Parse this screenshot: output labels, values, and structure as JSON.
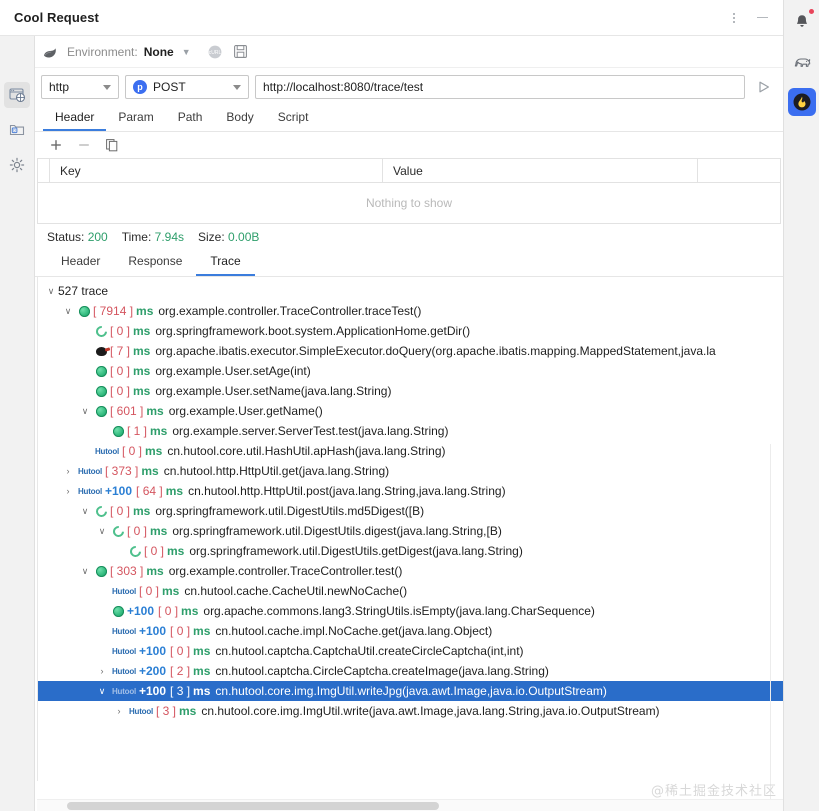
{
  "window": {
    "title": "Cool Request",
    "controls": {
      "menu_icon": "kebab-menu-icon",
      "minimize_icon": "minimize-icon"
    }
  },
  "left_rail": {
    "items": [
      {
        "name": "request-icon",
        "glyph": "globe-window-icon",
        "active": true
      },
      {
        "name": "collection-icon",
        "glyph": "folder-doc-icon",
        "active": false
      },
      {
        "name": "settings-icon",
        "glyph": "gear-icon",
        "active": false
      }
    ]
  },
  "right_rail": {
    "items": [
      {
        "name": "notifications-icon",
        "glyph": "bell-icon",
        "badge": true,
        "active": false
      },
      {
        "name": "plugin-icon",
        "glyph": "dinosaur-icon",
        "badge": false,
        "active": false
      },
      {
        "name": "coolrequest-icon",
        "glyph": "flame-icon",
        "badge": false,
        "active": true
      }
    ]
  },
  "environment_bar": {
    "leaf_icon": "spring-leaf-icon",
    "label": "Environment:",
    "value": "None",
    "caret": "∨",
    "curl_icon": "curl-icon",
    "save_icon": "save-disk-icon"
  },
  "url_bar": {
    "protocol": "http",
    "method": "POST",
    "method_badge": "p",
    "url": "http://localhost:8080/trace/test",
    "url_placeholder": "http://localhost:8080/trace/test",
    "send_icon": "send-play-icon",
    "accent": "#3b6ef0"
  },
  "request_tabs": {
    "items": [
      "Header",
      "Param",
      "Path",
      "Body",
      "Script"
    ],
    "active": "Header"
  },
  "kv_toolbar": {
    "add_label": "+",
    "remove_label": "−",
    "copy_icon": "copy-icon"
  },
  "kv_table": {
    "columns": [
      "Key",
      "Value"
    ],
    "rows": [],
    "empty_text": "Nothing to show"
  },
  "status": {
    "status_label": "Status:",
    "status_value": "200",
    "time_label": "Time:",
    "time_value": "7.94s",
    "size_label": "Size:",
    "size_value": "0.00B",
    "value_color": "#2e9e6b"
  },
  "response_tabs": {
    "items": [
      "Header",
      "Response",
      "Trace"
    ],
    "active": "Trace"
  },
  "trace": {
    "root_label": "527 trace",
    "selected_index": 19,
    "rows": [
      {
        "indent": 0,
        "twisty": "open",
        "icon": "none",
        "hutool": "",
        "plus": "",
        "dur": "",
        "ms": "",
        "sig": "527 trace",
        "root": true
      },
      {
        "indent": 1,
        "twisty": "open",
        "icon": "java",
        "hutool": "",
        "plus": "",
        "dur": "[ 7914 ]",
        "ms": "ms",
        "sig": "org.example.controller.TraceController.traceTest()"
      },
      {
        "indent": 2,
        "twisty": "none",
        "icon": "spring",
        "hutool": "",
        "plus": "",
        "dur": "[ 0 ]",
        "ms": "ms",
        "sig": "org.springframework.boot.system.ApplicationHome.getDir()"
      },
      {
        "indent": 2,
        "twisty": "none",
        "icon": "mybatis",
        "hutool": "",
        "plus": "",
        "dur": "[ 7 ]",
        "ms": "ms",
        "sig": "org.apache.ibatis.executor.SimpleExecutor.doQuery(org.apache.ibatis.mapping.MappedStatement,java.la"
      },
      {
        "indent": 2,
        "twisty": "none",
        "icon": "java",
        "hutool": "",
        "plus": "",
        "dur": "[ 0 ]",
        "ms": "ms",
        "sig": "org.example.User.setAge(int)"
      },
      {
        "indent": 2,
        "twisty": "none",
        "icon": "java",
        "hutool": "",
        "plus": "",
        "dur": "[ 0 ]",
        "ms": "ms",
        "sig": "org.example.User.setName(java.lang.String)"
      },
      {
        "indent": 2,
        "twisty": "open",
        "icon": "java",
        "hutool": "",
        "plus": "",
        "dur": "[ 601 ]",
        "ms": "ms",
        "sig": "org.example.User.getName()"
      },
      {
        "indent": 3,
        "twisty": "none",
        "icon": "java",
        "hutool": "",
        "plus": "",
        "dur": "[ 1 ]",
        "ms": "ms",
        "sig": "org.example.server.ServerTest.test(java.lang.String)"
      },
      {
        "indent": 2,
        "twisty": "none",
        "icon": "none",
        "hutool": "Hutool",
        "plus": "",
        "dur": "[ 0 ]",
        "ms": "ms",
        "sig": "cn.hutool.core.util.HashUtil.apHash(java.lang.String)"
      },
      {
        "indent": 1,
        "twisty": "closed",
        "icon": "none",
        "hutool": "Hutool",
        "plus": "",
        "dur": "[ 373 ]",
        "ms": "ms",
        "sig": "cn.hutool.http.HttpUtil.get(java.lang.String)"
      },
      {
        "indent": 1,
        "twisty": "closed",
        "icon": "none",
        "hutool": "Hutool",
        "plus": "+100",
        "dur": "[ 64 ]",
        "ms": "ms",
        "sig": "cn.hutool.http.HttpUtil.post(java.lang.String,java.lang.String)"
      },
      {
        "indent": 2,
        "twisty": "open",
        "icon": "spring",
        "hutool": "",
        "plus": "",
        "dur": "[ 0 ]",
        "ms": "ms",
        "sig": "org.springframework.util.DigestUtils.md5Digest([B)"
      },
      {
        "indent": 3,
        "twisty": "open",
        "icon": "spring",
        "hutool": "",
        "plus": "",
        "dur": "[ 0 ]",
        "ms": "ms",
        "sig": "org.springframework.util.DigestUtils.digest(java.lang.String,[B)"
      },
      {
        "indent": 4,
        "twisty": "none",
        "icon": "spring",
        "hutool": "",
        "plus": "",
        "dur": "[ 0 ]",
        "ms": "ms",
        "sig": "org.springframework.util.DigestUtils.getDigest(java.lang.String)"
      },
      {
        "indent": 2,
        "twisty": "open",
        "icon": "java",
        "hutool": "",
        "plus": "",
        "dur": "[ 303 ]",
        "ms": "ms",
        "sig": "org.example.controller.TraceController.test()"
      },
      {
        "indent": 3,
        "twisty": "none",
        "icon": "none",
        "hutool": "Hutool",
        "plus": "",
        "dur": "[ 0 ]",
        "ms": "ms",
        "sig": "cn.hutool.cache.CacheUtil.newNoCache()"
      },
      {
        "indent": 3,
        "twisty": "none",
        "icon": "java",
        "hutool": "",
        "plus": "+100",
        "dur": "[ 0 ]",
        "ms": "ms",
        "sig": "org.apache.commons.lang3.StringUtils.isEmpty(java.lang.CharSequence)"
      },
      {
        "indent": 3,
        "twisty": "none",
        "icon": "none",
        "hutool": "Hutool",
        "plus": "+100",
        "dur": "[ 0 ]",
        "ms": "ms",
        "sig": "cn.hutool.cache.impl.NoCache.get(java.lang.Object)"
      },
      {
        "indent": 3,
        "twisty": "none",
        "icon": "none",
        "hutool": "Hutool",
        "plus": "+100",
        "dur": "[ 0 ]",
        "ms": "ms",
        "sig": "cn.hutool.captcha.CaptchaUtil.createCircleCaptcha(int,int)"
      },
      {
        "indent": 3,
        "twisty": "closed",
        "icon": "none",
        "hutool": "Hutool",
        "plus": "+200",
        "dur": "[ 2 ]",
        "ms": "ms",
        "sig": "cn.hutool.captcha.CircleCaptcha.createImage(java.lang.String)"
      },
      {
        "indent": 3,
        "twisty": "open",
        "icon": "none",
        "hutool": "Hutool",
        "plus": "+100",
        "dur": "[ 3 ]",
        "ms": "ms",
        "sig": "cn.hutool.core.img.ImgUtil.writeJpg(java.awt.Image,java.io.OutputStream)",
        "selected": true
      },
      {
        "indent": 4,
        "twisty": "closed",
        "icon": "none",
        "hutool": "Hutool",
        "plus": "",
        "dur": "[ 3 ]",
        "ms": "ms",
        "sig": "cn.hutool.core.img.ImgUtil.write(java.awt.Image,java.lang.String,java.io.OutputStream)"
      }
    ],
    "colors": {
      "duration": "#d4555f",
      "unit": "#2e9e6b",
      "hutool_badge": "#2b6cb0",
      "plus_count": "#2b7fd4",
      "selection": "#2a6dc9"
    }
  },
  "watermark": {
    "text": "@稀土掘金技术社区"
  }
}
